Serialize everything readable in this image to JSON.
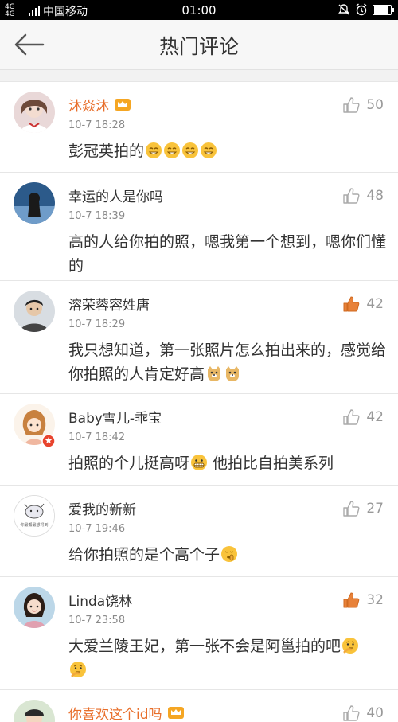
{
  "status": {
    "network": "4G 4G",
    "carrier": "中国移动",
    "time": "01:00"
  },
  "header": {
    "title": "热门评论"
  },
  "comments": [
    {
      "name": "沐焱沐",
      "time": "10-7 18:28",
      "text": "彭冠英拍的",
      "likes": "50",
      "vip": true,
      "liked": false
    },
    {
      "name": "幸运的人是你吗",
      "time": "10-7 18:39",
      "text": "高的人给你拍的照，嗯我第一个想到，嗯你们懂的",
      "likes": "48",
      "vip": false,
      "liked": false
    },
    {
      "name": "溶荣蓉容姓唐",
      "time": "10-7 18:29",
      "text": "我只想知道，第一张照片怎么拍出来的，感觉给你拍照的人肯定好高",
      "likes": "42",
      "vip": false,
      "liked": true
    },
    {
      "name": "Baby雪儿-乖宝",
      "time": "10-7 18:42",
      "text_before": "拍照的个儿挺高呀",
      "text_after": " 他拍比自拍美系列",
      "likes": "42",
      "vip": false,
      "liked": false
    },
    {
      "name": "爱我的新新",
      "time": "10-7 19:46",
      "text": "给你拍照的是个高个子",
      "likes": "27",
      "vip": false,
      "liked": false
    },
    {
      "name": "Linda饶林",
      "time": "10-7 23:58",
      "text": "大爱兰陵王妃，第一张不会是阿邕拍的吧",
      "likes": "32",
      "vip": false,
      "liked": true
    },
    {
      "name": "你喜欢这个id吗",
      "likes": "40",
      "vip": true,
      "liked": false
    }
  ],
  "avatar_text": "你最帮最想得到",
  "colors": {
    "accent": "#e86e2a",
    "like_active": "#e8823a"
  }
}
